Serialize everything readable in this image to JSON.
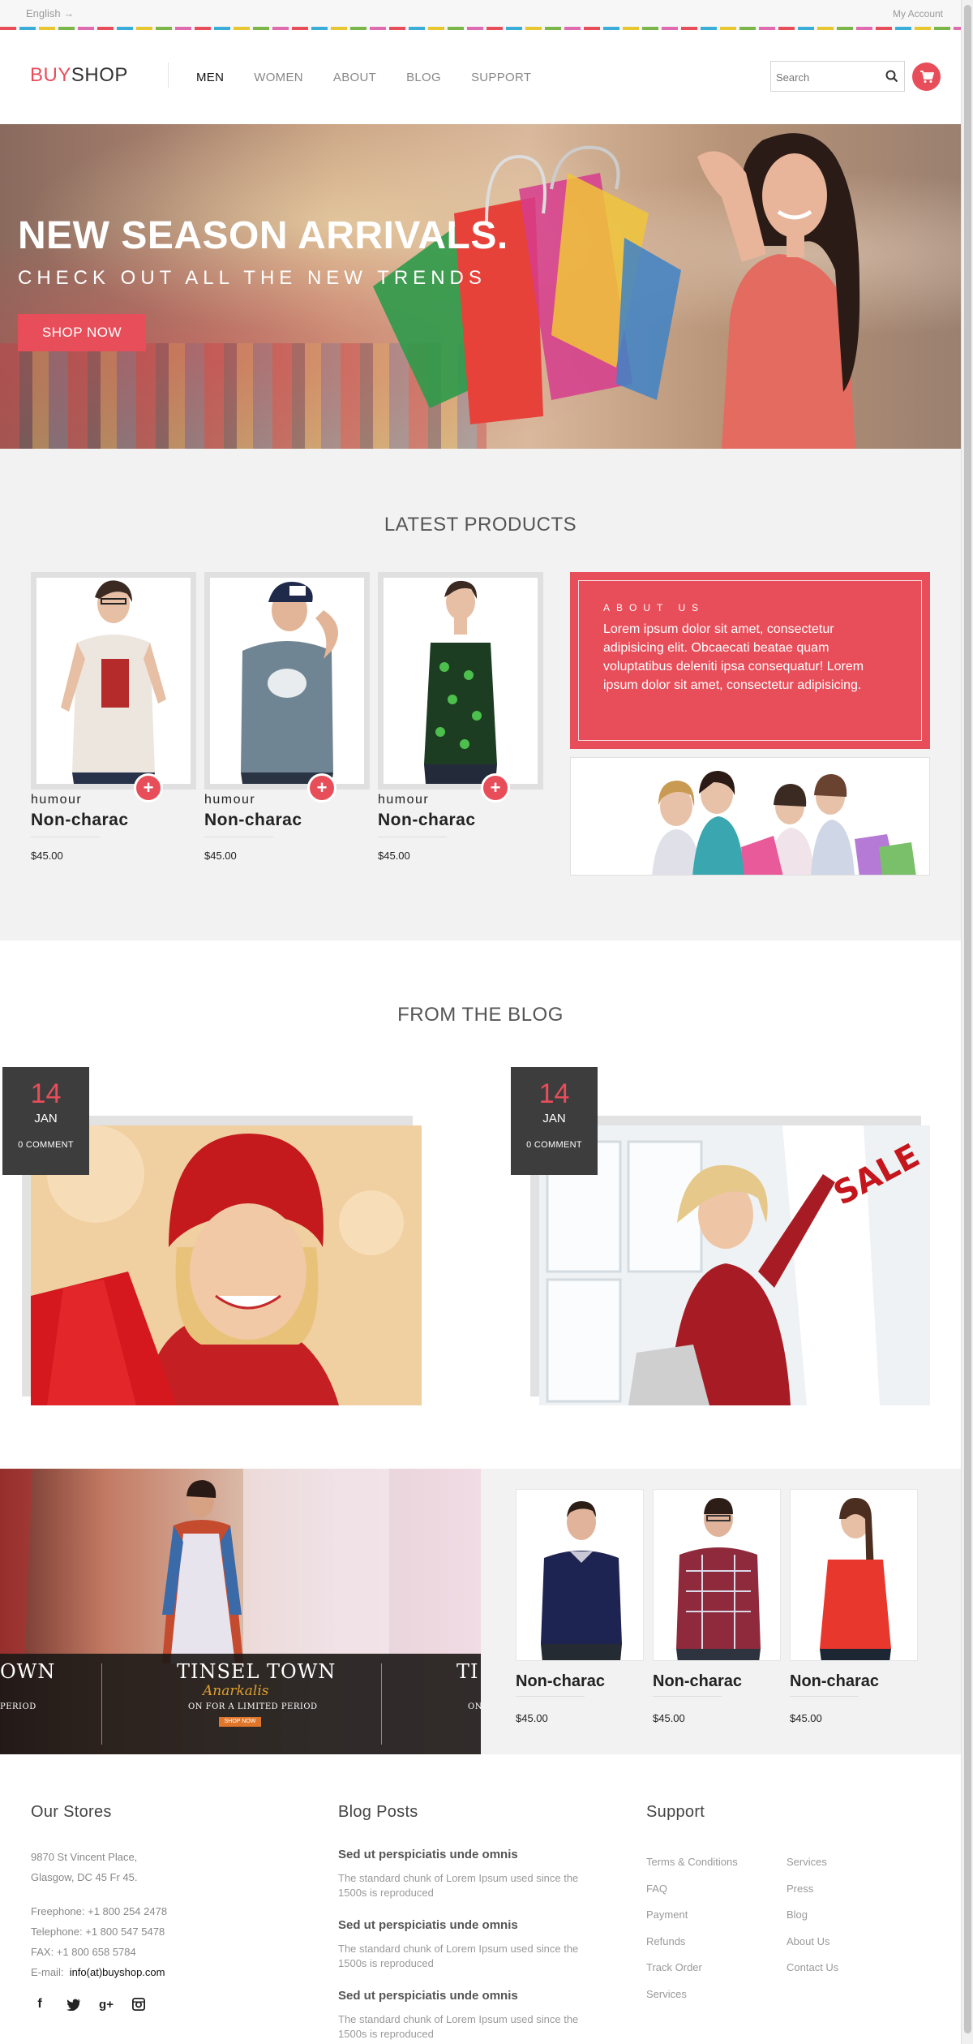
{
  "topbar": {
    "language": "English →",
    "account": "My Account"
  },
  "header": {
    "logo_a": "BUY",
    "logo_b": "SHOP",
    "nav": [
      "MEN",
      "WOMEN",
      "ABOUT",
      "BLOG",
      "SUPPORT"
    ],
    "search_placeholder": "Search"
  },
  "hero": {
    "title": "NEW SEASON ARRIVALS.",
    "subtitle": "CHECK OUT ALL THE NEW TRENDS",
    "button": "SHOP NOW"
  },
  "latest": {
    "title": "LATEST PRODUCTS",
    "products": [
      {
        "category": "humour",
        "name": "Non-charac",
        "price": "$45.00"
      },
      {
        "category": "humour",
        "name": "Non-charac",
        "price": "$45.00"
      },
      {
        "category": "humour",
        "name": "Non-charac",
        "price": "$45.00"
      }
    ],
    "about": {
      "heading": "ABOUT US",
      "text": "Lorem ipsum dolor sit amet, consectetur adipisicing elit. Obcaecati beatae quam voluptatibus deleniti ipsa consequatur! Lorem ipsum dolor sit amet, consectetur adipisicing."
    }
  },
  "blog": {
    "title": "FROM THE BLOG",
    "posts": [
      {
        "day": "14",
        "month": "JAN",
        "comments": "0 COMMENT"
      },
      {
        "day": "14",
        "month": "JAN",
        "comments": "0 COMMENT"
      }
    ],
    "sale_text": "SALE"
  },
  "promo": {
    "banner_title": "TINSEL TOWN",
    "banner_sub": "Anarkalis",
    "banner_offer": "ON FOR A LIMITED PERIOD",
    "banner_button": "SHOP NOW",
    "banner_left_title": "OWN",
    "banner_left_offer": "PERIOD",
    "banner_right_title": "TI",
    "banner_right_offer": "ON",
    "products": [
      {
        "name": "Non-charac",
        "price": "$45.00"
      },
      {
        "name": "Non-charac",
        "price": "$45.00"
      },
      {
        "name": "Non-charac",
        "price": "$45.00"
      }
    ]
  },
  "footer": {
    "stores": {
      "title": "Our Stores",
      "address1": "9870 St Vincent Place,",
      "address2": "Glasgow, DC 45 Fr 45.",
      "freephone": "Freephone: +1 800 254 2478",
      "telephone": "Telephone: +1 800 547 5478",
      "fax": "FAX: +1 800 658 5784",
      "email_label": "E-mail:",
      "email": "info(at)buyshop.com"
    },
    "blog": {
      "title": "Blog Posts",
      "posts": [
        {
          "title": "Sed ut perspiciatis unde omnis",
          "excerpt": "The standard chunk of Lorem Ipsum used since the 1500s is reproduced"
        },
        {
          "title": "Sed ut perspiciatis unde omnis",
          "excerpt": "The standard chunk of Lorem Ipsum used since the 1500s is reproduced"
        },
        {
          "title": "Sed ut perspiciatis unde omnis",
          "excerpt": "The standard chunk of Lorem Ipsum used since the 1500s is reproduced"
        }
      ]
    },
    "support": {
      "title": "Support",
      "col1": [
        "Terms & Conditions",
        "FAQ",
        "Payment",
        "Refunds",
        "Track Order",
        "Services"
      ],
      "col2": [
        "Services",
        "Press",
        "Blog",
        "About Us",
        "Contact Us"
      ]
    },
    "social_icons": [
      "facebook-icon",
      "twitter-icon",
      "google-plus-icon",
      "instagram-icon"
    ]
  },
  "colors": {
    "accent": "#e84e5a",
    "dark": "#3d3d3d",
    "light_bg": "#f2f2f2"
  }
}
